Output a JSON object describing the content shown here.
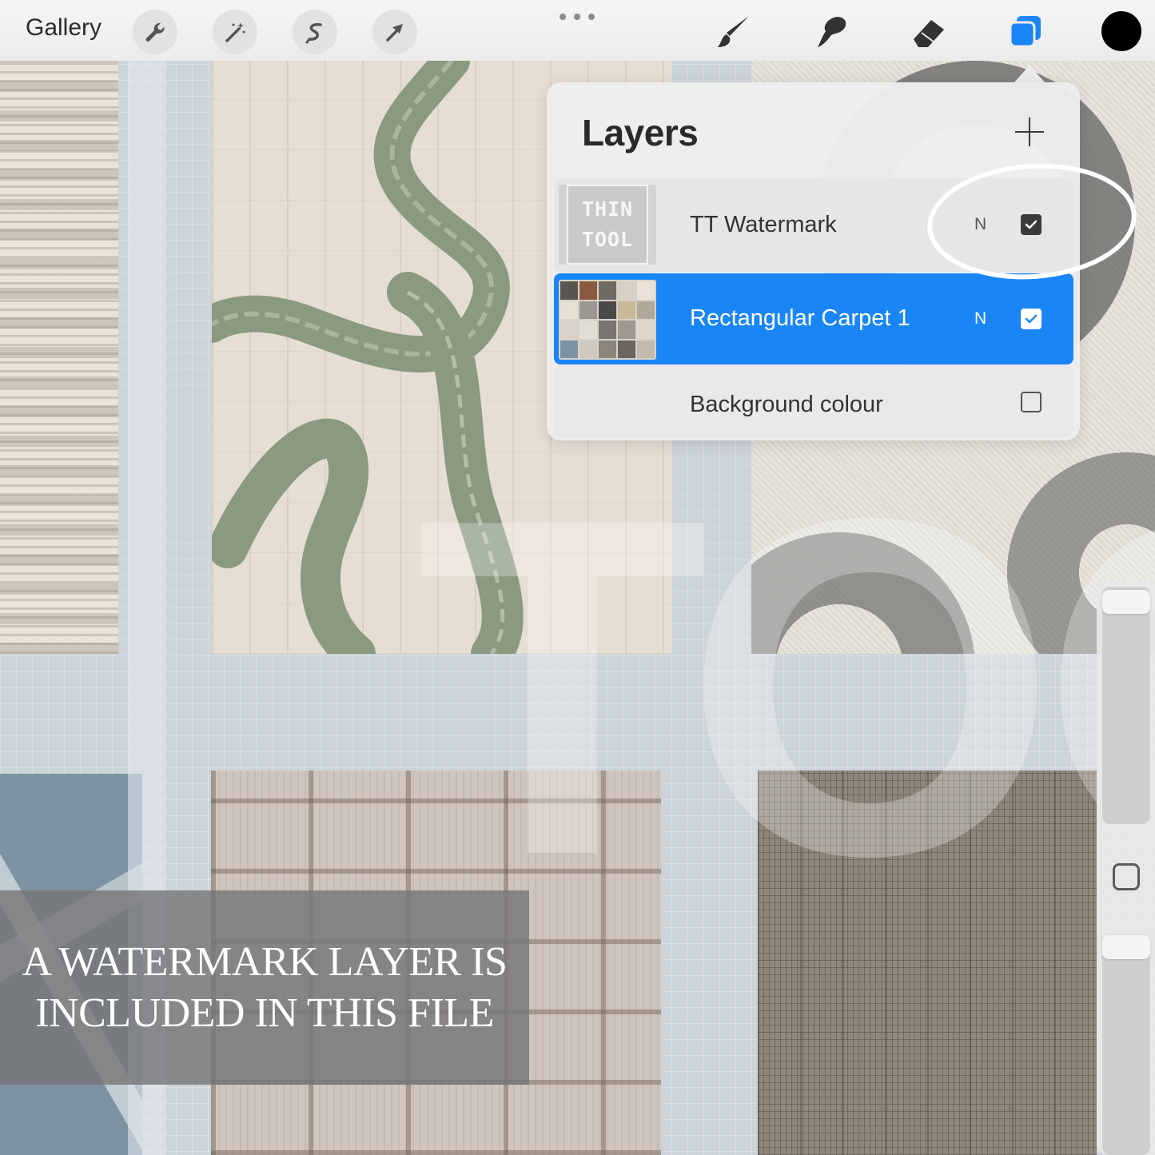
{
  "toolbar": {
    "gallery_label": "Gallery",
    "left_tools": [
      {
        "name": "actions",
        "icon": "wrench-icon"
      },
      {
        "name": "adjustments",
        "icon": "magic-wand-icon"
      },
      {
        "name": "selection",
        "icon": "selection-icon"
      },
      {
        "name": "transform",
        "icon": "arrow-icon"
      }
    ],
    "right_tools": [
      {
        "name": "brush",
        "icon": "brush-icon"
      },
      {
        "name": "smudge",
        "icon": "smudge-icon"
      },
      {
        "name": "eraser",
        "icon": "eraser-icon"
      },
      {
        "name": "layers",
        "icon": "layers-icon",
        "active": true
      }
    ],
    "current_color": "#000000",
    "accent_color": "#1a86f6"
  },
  "layers_panel": {
    "title": "Layers",
    "add_icon": "plus-icon",
    "layers": [
      {
        "name": "TT Watermark",
        "blend_mode": "N",
        "visible": true,
        "selected": false,
        "thumbnail_text": [
          "THIN",
          "TOOL"
        ]
      },
      {
        "name": "Rectangular Carpet 1",
        "blend_mode": "N",
        "visible": true,
        "selected": true
      },
      {
        "name": "Background colour",
        "visible": false,
        "selected": false
      }
    ]
  },
  "caption": {
    "line1": "A WATERMARK LAYER IS",
    "line2": "INCLUDED IN THIS FILE"
  },
  "watermark_text": "TOO"
}
